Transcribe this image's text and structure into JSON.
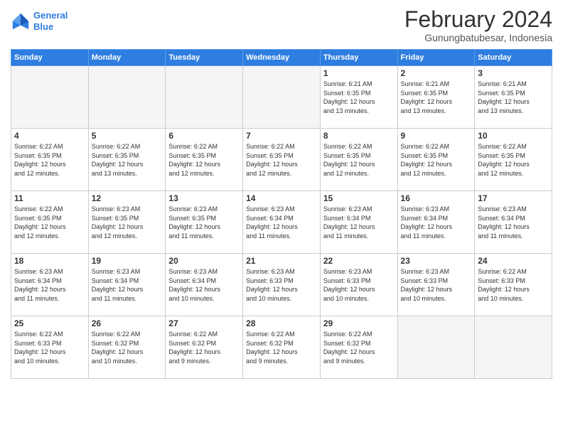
{
  "header": {
    "logo_line1": "General",
    "logo_line2": "Blue",
    "month_title": "February 2024",
    "subtitle": "Gunungbatubesar, Indonesia"
  },
  "weekdays": [
    "Sunday",
    "Monday",
    "Tuesday",
    "Wednesday",
    "Thursday",
    "Friday",
    "Saturday"
  ],
  "weeks": [
    [
      {
        "num": "",
        "info": ""
      },
      {
        "num": "",
        "info": ""
      },
      {
        "num": "",
        "info": ""
      },
      {
        "num": "",
        "info": ""
      },
      {
        "num": "1",
        "info": "Sunrise: 6:21 AM\nSunset: 6:35 PM\nDaylight: 12 hours\nand 13 minutes."
      },
      {
        "num": "2",
        "info": "Sunrise: 6:21 AM\nSunset: 6:35 PM\nDaylight: 12 hours\nand 13 minutes."
      },
      {
        "num": "3",
        "info": "Sunrise: 6:21 AM\nSunset: 6:35 PM\nDaylight: 12 hours\nand 13 minutes."
      }
    ],
    [
      {
        "num": "4",
        "info": "Sunrise: 6:22 AM\nSunset: 6:35 PM\nDaylight: 12 hours\nand 12 minutes."
      },
      {
        "num": "5",
        "info": "Sunrise: 6:22 AM\nSunset: 6:35 PM\nDaylight: 12 hours\nand 13 minutes."
      },
      {
        "num": "6",
        "info": "Sunrise: 6:22 AM\nSunset: 6:35 PM\nDaylight: 12 hours\nand 12 minutes."
      },
      {
        "num": "7",
        "info": "Sunrise: 6:22 AM\nSunset: 6:35 PM\nDaylight: 12 hours\nand 12 minutes."
      },
      {
        "num": "8",
        "info": "Sunrise: 6:22 AM\nSunset: 6:35 PM\nDaylight: 12 hours\nand 12 minutes."
      },
      {
        "num": "9",
        "info": "Sunrise: 6:22 AM\nSunset: 6:35 PM\nDaylight: 12 hours\nand 12 minutes."
      },
      {
        "num": "10",
        "info": "Sunrise: 6:22 AM\nSunset: 6:35 PM\nDaylight: 12 hours\nand 12 minutes."
      }
    ],
    [
      {
        "num": "11",
        "info": "Sunrise: 6:22 AM\nSunset: 6:35 PM\nDaylight: 12 hours\nand 12 minutes."
      },
      {
        "num": "12",
        "info": "Sunrise: 6:23 AM\nSunset: 6:35 PM\nDaylight: 12 hours\nand 12 minutes."
      },
      {
        "num": "13",
        "info": "Sunrise: 6:23 AM\nSunset: 6:35 PM\nDaylight: 12 hours\nand 11 minutes."
      },
      {
        "num": "14",
        "info": "Sunrise: 6:23 AM\nSunset: 6:34 PM\nDaylight: 12 hours\nand 11 minutes."
      },
      {
        "num": "15",
        "info": "Sunrise: 6:23 AM\nSunset: 6:34 PM\nDaylight: 12 hours\nand 11 minutes."
      },
      {
        "num": "16",
        "info": "Sunrise: 6:23 AM\nSunset: 6:34 PM\nDaylight: 12 hours\nand 11 minutes."
      },
      {
        "num": "17",
        "info": "Sunrise: 6:23 AM\nSunset: 6:34 PM\nDaylight: 12 hours\nand 11 minutes."
      }
    ],
    [
      {
        "num": "18",
        "info": "Sunrise: 6:23 AM\nSunset: 6:34 PM\nDaylight: 12 hours\nand 11 minutes."
      },
      {
        "num": "19",
        "info": "Sunrise: 6:23 AM\nSunset: 6:34 PM\nDaylight: 12 hours\nand 11 minutes."
      },
      {
        "num": "20",
        "info": "Sunrise: 6:23 AM\nSunset: 6:34 PM\nDaylight: 12 hours\nand 10 minutes."
      },
      {
        "num": "21",
        "info": "Sunrise: 6:23 AM\nSunset: 6:33 PM\nDaylight: 12 hours\nand 10 minutes."
      },
      {
        "num": "22",
        "info": "Sunrise: 6:23 AM\nSunset: 6:33 PM\nDaylight: 12 hours\nand 10 minutes."
      },
      {
        "num": "23",
        "info": "Sunrise: 6:23 AM\nSunset: 6:33 PM\nDaylight: 12 hours\nand 10 minutes."
      },
      {
        "num": "24",
        "info": "Sunrise: 6:22 AM\nSunset: 6:33 PM\nDaylight: 12 hours\nand 10 minutes."
      }
    ],
    [
      {
        "num": "25",
        "info": "Sunrise: 6:22 AM\nSunset: 6:33 PM\nDaylight: 12 hours\nand 10 minutes."
      },
      {
        "num": "26",
        "info": "Sunrise: 6:22 AM\nSunset: 6:32 PM\nDaylight: 12 hours\nand 10 minutes."
      },
      {
        "num": "27",
        "info": "Sunrise: 6:22 AM\nSunset: 6:32 PM\nDaylight: 12 hours\nand 9 minutes."
      },
      {
        "num": "28",
        "info": "Sunrise: 6:22 AM\nSunset: 6:32 PM\nDaylight: 12 hours\nand 9 minutes."
      },
      {
        "num": "29",
        "info": "Sunrise: 6:22 AM\nSunset: 6:32 PM\nDaylight: 12 hours\nand 9 minutes."
      },
      {
        "num": "",
        "info": ""
      },
      {
        "num": "",
        "info": ""
      }
    ]
  ]
}
